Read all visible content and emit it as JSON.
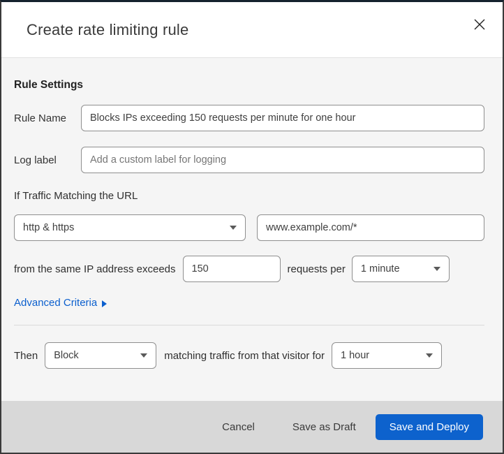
{
  "dialog": {
    "title": "Create rate limiting rule"
  },
  "rule_settings": {
    "heading": "Rule Settings",
    "rule_name": {
      "label": "Rule Name",
      "value": "Blocks IPs exceeding 150 requests per minute for one hour"
    },
    "log_label": {
      "label": "Log label",
      "placeholder": "Add a custom label for logging"
    },
    "traffic_match": {
      "intro": "If Traffic Matching the URL",
      "scheme_selected": "http & https",
      "url_value": "www.example.com/*"
    },
    "threshold": {
      "prefix": "from the same IP address exceeds",
      "requests_value": "150",
      "middle": "requests per",
      "period_selected": "1 minute"
    },
    "advanced_criteria_label": "Advanced Criteria"
  },
  "action": {
    "then_label": "Then",
    "action_selected": "Block",
    "middle": "matching traffic from that visitor for",
    "duration_selected": "1 hour"
  },
  "footer": {
    "cancel_label": "Cancel",
    "save_draft_label": "Save as Draft",
    "save_deploy_label": "Save and Deploy"
  },
  "colors": {
    "accent_blue": "#0d62cd",
    "link_blue": "#0b5fce",
    "body_bg": "#f5f5f5",
    "footer_bg": "#d8d8d8"
  }
}
